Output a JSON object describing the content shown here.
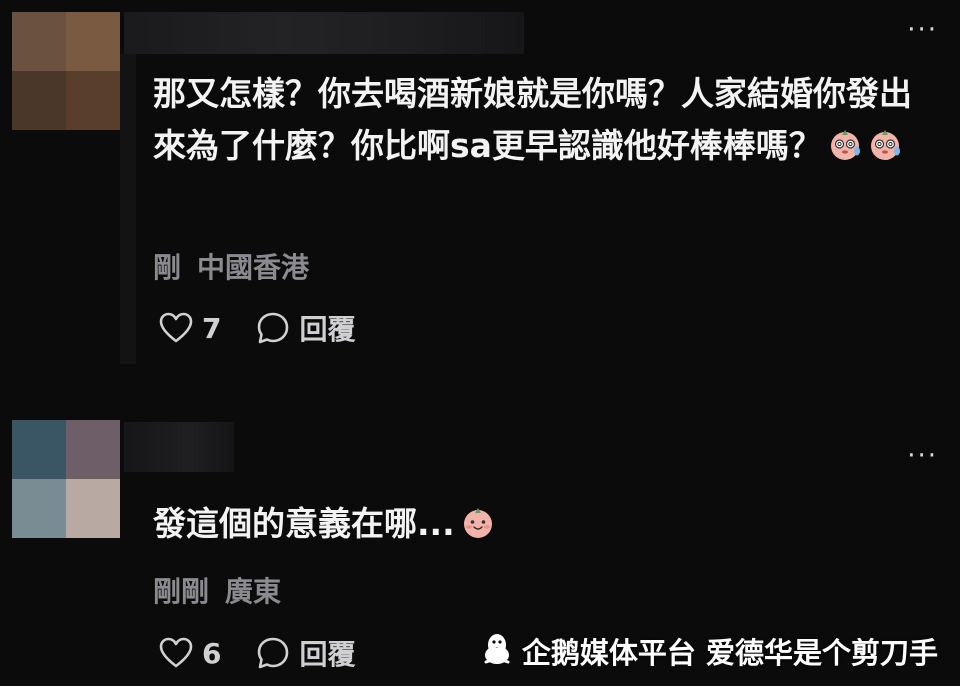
{
  "comments": [
    {
      "text": "那又怎樣？你去喝酒新娘就是你嗎？人家結婚你發出來為了什麼？你比啊sa更早認識他好棒棒嗎？",
      "emoji": [
        "face-with-spiral-eyes-sweat",
        "face-with-spiral-eyes-sweat"
      ],
      "time": "剛",
      "location": "中國香港",
      "likes": "7",
      "reply_label": "回覆",
      "avatar_colors": [
        "#6b5240",
        "#7a5a40",
        "#4a372a",
        "#5a3e2c"
      ]
    },
    {
      "text": "發這個的意義在哪...",
      "emoji": [
        "smiling-face-blush"
      ],
      "time": "剛剛",
      "location": "廣東",
      "likes": "6",
      "reply_label": "回覆",
      "avatar_colors": [
        "#3a5563",
        "#6e5e68",
        "#7a8c93",
        "#b8aaa3"
      ]
    }
  ],
  "more_label": "···",
  "watermark": {
    "icon": "penguin-icon",
    "text": "企鹅媒体平台 爱德华是个剪刀手"
  },
  "colors": {
    "background": "#0b0b0c",
    "text": "#f3f3f3",
    "meta": "#8b8b8f"
  }
}
